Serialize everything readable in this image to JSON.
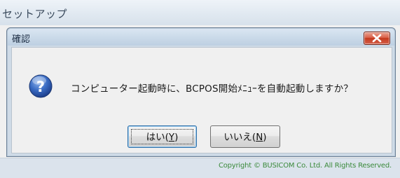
{
  "outer_window": {
    "title": "セットアップ",
    "copyright": "Copyright © BUSICOM Co. Ltd. All Rights Reserved."
  },
  "dialog": {
    "title": "確認",
    "message": "コンピューター起動時に、BCPOS開始ﾒﾆｭｰを自動起動しますか？",
    "icon": "question-icon",
    "buttons": {
      "yes": {
        "label": "はい(",
        "mnemonic": "Y",
        "suffix": ")"
      },
      "no": {
        "label": "いいえ(",
        "mnemonic": "N",
        "suffix": ")"
      }
    }
  },
  "colors": {
    "close_button": "#c4381d",
    "question_icon": "#2f5fb3",
    "copyright_text": "#3b8a3b"
  }
}
